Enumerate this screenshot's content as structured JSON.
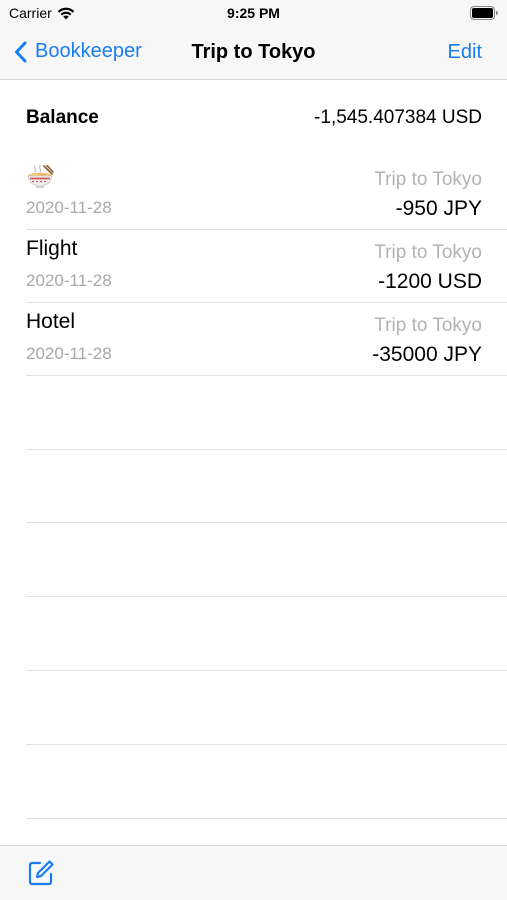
{
  "status_bar": {
    "carrier": "Carrier",
    "time": "9:25 PM"
  },
  "nav": {
    "back_label": "Bookkeeper",
    "title": "Trip to Tokyo",
    "edit_label": "Edit"
  },
  "balance": {
    "label": "Balance",
    "value": "-1,545.407384 USD"
  },
  "transactions": [
    {
      "name": "",
      "icon": "ramen-bowl-icon",
      "date": "2020-11-28",
      "book": "Trip to Tokyo",
      "amount": "-950 JPY"
    },
    {
      "name": "Flight",
      "date": "2020-11-28",
      "book": "Trip to Tokyo",
      "amount": "-1200 USD"
    },
    {
      "name": "Hotel",
      "date": "2020-11-28",
      "book": "Trip to Tokyo",
      "amount": "-35000 JPY"
    }
  ],
  "toolbar": {
    "compose_icon": "compose-icon"
  },
  "colors": {
    "accent": "#1a7cf3",
    "secondary_text": "#a8a8ad",
    "bar_background": "#f7f7f8"
  }
}
